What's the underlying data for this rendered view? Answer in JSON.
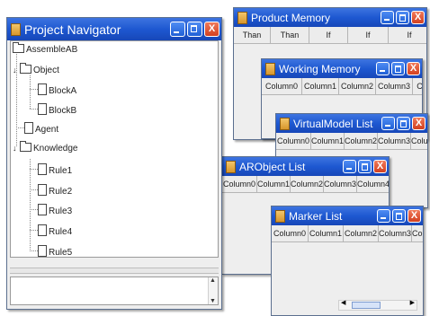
{
  "windows": {
    "project_navigator": {
      "title": "Project Navigator",
      "tree": {
        "root": "AssembleAB",
        "object": "Object",
        "blocks": [
          "BlockA",
          "BlockB"
        ],
        "agent": "Agent",
        "knowledge": "Knowledge",
        "rules": [
          "Rule1",
          "Rule2",
          "Rule3",
          "Rule4",
          "Rule5"
        ]
      }
    },
    "product_memory": {
      "title": "Product Memory",
      "columns": [
        "Than",
        "Than",
        "If",
        "If",
        "If"
      ]
    },
    "working_memory": {
      "title": "Working Memory",
      "columns": [
        "Column0",
        "Column1",
        "Column2",
        "Column3",
        "Co"
      ]
    },
    "virtualmodel_list": {
      "title": "VirtualModel List",
      "columns": [
        "Column0",
        "Column1",
        "Column2",
        "Column3",
        "Colum"
      ]
    },
    "arobject_list": {
      "title": "ARObject List",
      "columns": [
        "Column0",
        "Column1",
        "Column2",
        "Column3",
        "Column4"
      ]
    },
    "marker_list": {
      "title": "Marker List",
      "columns": [
        "Column0",
        "Column1",
        "Column2",
        "Column3",
        "Colu"
      ]
    }
  },
  "colors": {
    "titlebar": "#1e58d1",
    "close_button": "#d24020"
  },
  "icons": {
    "minimize": "minimize-icon",
    "maximize": "maximize-icon",
    "close": "close-icon",
    "document": "document-icon",
    "folder": "folder-icon"
  }
}
